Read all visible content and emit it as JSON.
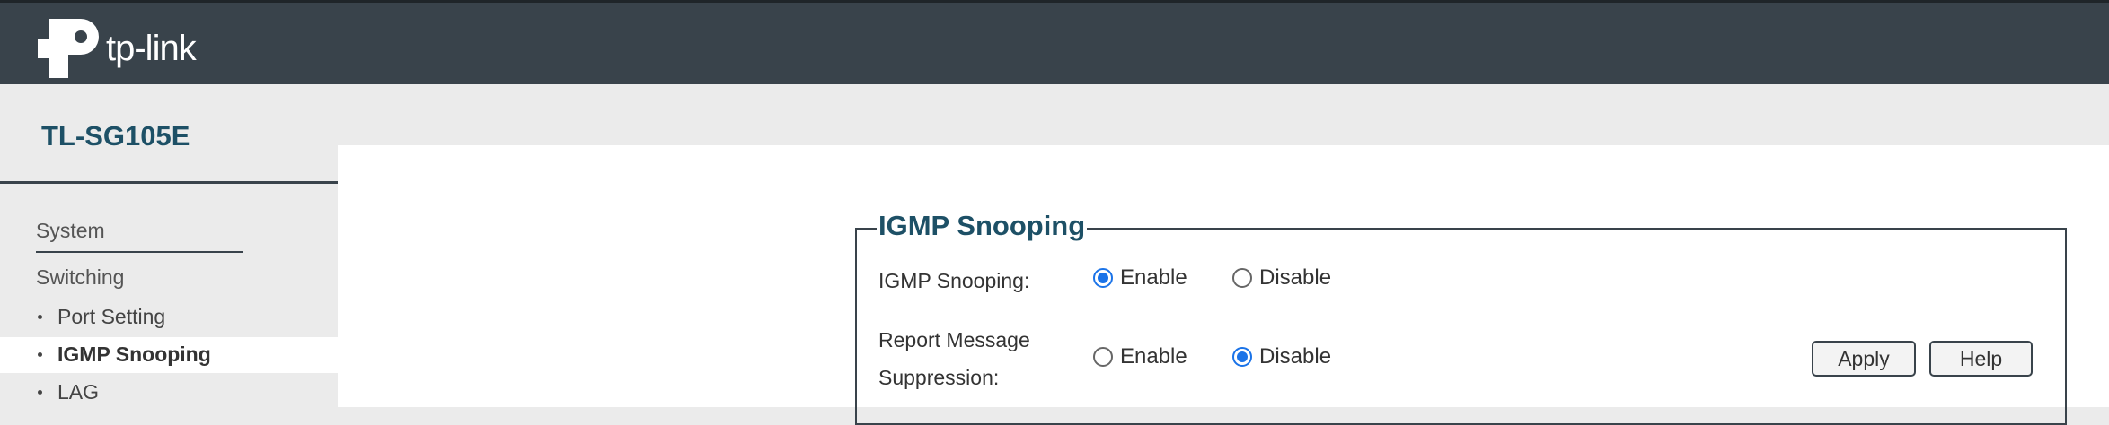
{
  "brand": {
    "logo_text": "tp-link"
  },
  "device": {
    "model": "TL-SG105E"
  },
  "nav": {
    "system": "System",
    "switching": "Switching",
    "sub_items": [
      {
        "label": "Port Setting"
      },
      {
        "label": "IGMP Snooping"
      },
      {
        "label": "LAG"
      }
    ]
  },
  "panel": {
    "title": "IGMP Snooping",
    "igmp_label": "IGMP Snooping:",
    "report_label_1": "Report Message",
    "report_label_2": "Suppression:",
    "enable": "Enable",
    "disable": "Disable",
    "igmp_selected": "Enable",
    "report_selected": "Disable"
  },
  "buttons": {
    "apply": "Apply",
    "help": "Help"
  },
  "colors": {
    "header": "#39434b",
    "title": "#1d5066",
    "radio": "#1a73e8"
  }
}
